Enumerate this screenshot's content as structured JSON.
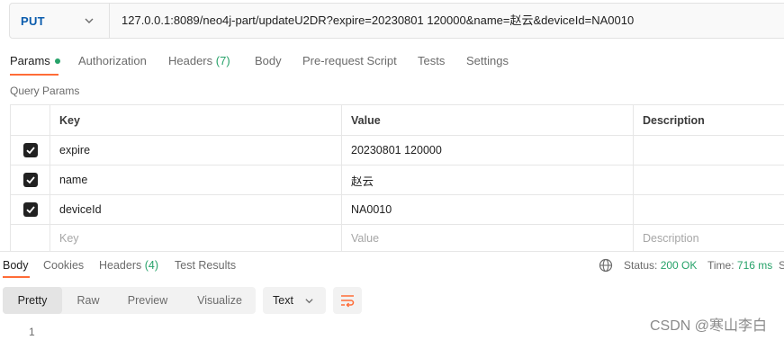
{
  "request": {
    "method": "PUT",
    "url": "127.0.0.1:8089/neo4j-part/updateU2DR?expire=20230801 120000&name=赵云&deviceId=NA0010"
  },
  "request_tabs": [
    {
      "label": "Params",
      "active": true
    },
    {
      "label": "Authorization"
    },
    {
      "label": "Headers",
      "count": "(7)"
    },
    {
      "label": "Body"
    },
    {
      "label": "Pre-request Script"
    },
    {
      "label": "Tests"
    },
    {
      "label": "Settings"
    }
  ],
  "query_params": {
    "title": "Query Params",
    "headers": {
      "key": "Key",
      "value": "Value",
      "description": "Description"
    },
    "rows": [
      {
        "checked": true,
        "key": "expire",
        "value": "20230801 120000"
      },
      {
        "checked": true,
        "key": "name",
        "value": "赵云"
      },
      {
        "checked": true,
        "key": "deviceId",
        "value": "NA0010"
      }
    ],
    "placeholder": {
      "key": "Key",
      "value": "Value",
      "description": "Description"
    }
  },
  "response_tabs": [
    {
      "label": "Body",
      "active": true
    },
    {
      "label": "Cookies"
    },
    {
      "label": "Headers",
      "count": "(4)"
    },
    {
      "label": "Test Results"
    }
  ],
  "response_status": {
    "status_label": "Status:",
    "status_value": "200 OK",
    "time_label": "Time:",
    "time_value": "716 ms",
    "size_label": "S"
  },
  "view_modes": [
    {
      "label": "Pretty",
      "active": true
    },
    {
      "label": "Raw"
    },
    {
      "label": "Preview"
    },
    {
      "label": "Visualize"
    }
  ],
  "format_select": "Text",
  "body_line_number": "1",
  "watermark": "CSDN @寒山李白",
  "colors": {
    "accent": "#ff6c37",
    "method": "#0b5cad",
    "success": "#26a269"
  }
}
